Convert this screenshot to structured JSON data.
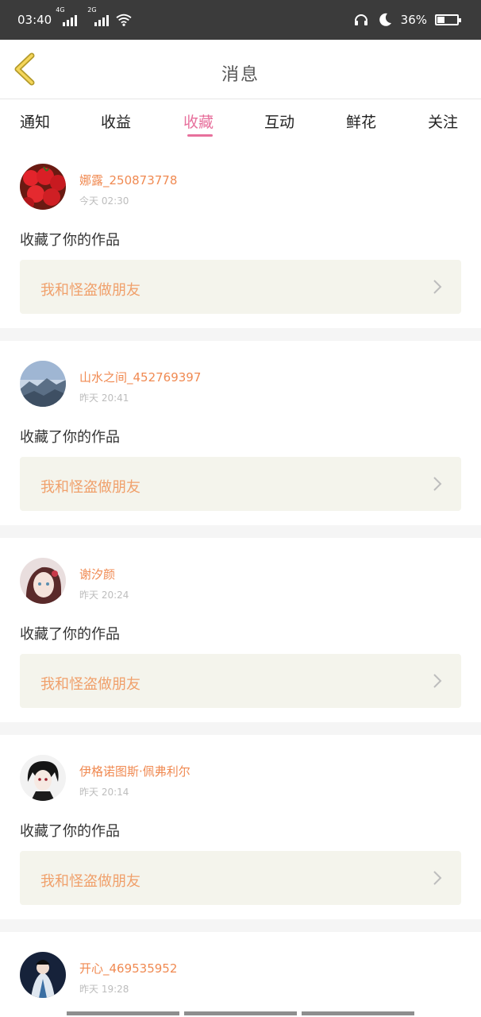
{
  "status": {
    "time": "03:40",
    "net1": "4G",
    "net2": "2G",
    "battery_text": "36%",
    "battery_level": 0.36
  },
  "header": {
    "title": "消息"
  },
  "tabs": [
    {
      "label": "通知",
      "active": false
    },
    {
      "label": "收益",
      "active": false
    },
    {
      "label": "收藏",
      "active": true
    },
    {
      "label": "互动",
      "active": false
    },
    {
      "label": "鲜花",
      "active": false
    },
    {
      "label": "关注",
      "active": false
    }
  ],
  "colors": {
    "accent": "#e7709c",
    "username": "#f08a52",
    "work_title": "#f0a06b",
    "work_bg": "#f4f4ec"
  },
  "messages": [
    {
      "user": "娜露_250873778",
      "time": "今天 02:30",
      "action": "收藏了你的作品",
      "work": "我和怪盗做朋友",
      "avatar": "cherries"
    },
    {
      "user": "山水之间_452769397",
      "time": "昨天 20:41",
      "action": "收藏了你的作品",
      "work": "我和怪盗做朋友",
      "avatar": "mountains"
    },
    {
      "user": "谢汐颜",
      "time": "昨天 20:24",
      "action": "收藏了你的作品",
      "work": "我和怪盗做朋友",
      "avatar": "anime-girl"
    },
    {
      "user": "伊格诺图斯·佩弗利尔",
      "time": "昨天 20:14",
      "action": "收藏了你的作品",
      "work": "我和怪盗做朋友",
      "avatar": "anime-boy"
    },
    {
      "user": "开心_469535952",
      "time": "昨天 19:28",
      "action": "",
      "work": "",
      "avatar": "costume-figure"
    }
  ]
}
